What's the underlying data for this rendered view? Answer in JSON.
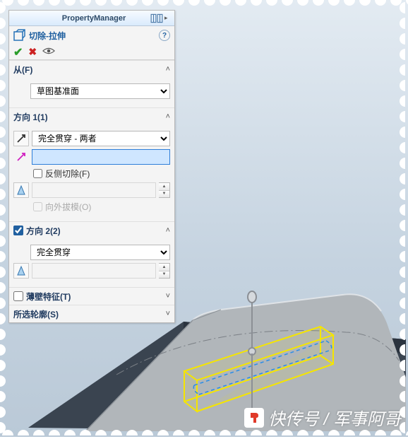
{
  "panel": {
    "title": "PropertyManager",
    "feature": {
      "title": "切除-拉伸"
    },
    "from": {
      "title": "从(F)",
      "option": "草图基准面"
    },
    "dir1": {
      "title": "方向 1(1)",
      "end_condition": "完全贯穿 - 两者",
      "value": "",
      "flip_label": "反侧切除(F)",
      "draft_label": "向外拔模(O)"
    },
    "dir2": {
      "title": "方向 2(2)",
      "end_condition": "完全贯穿"
    },
    "thin": {
      "title": "薄壁特征(T)"
    },
    "contours": {
      "title": "所选轮廓(S)"
    }
  },
  "watermark": {
    "text": "快传号 / 军事阿哥"
  }
}
